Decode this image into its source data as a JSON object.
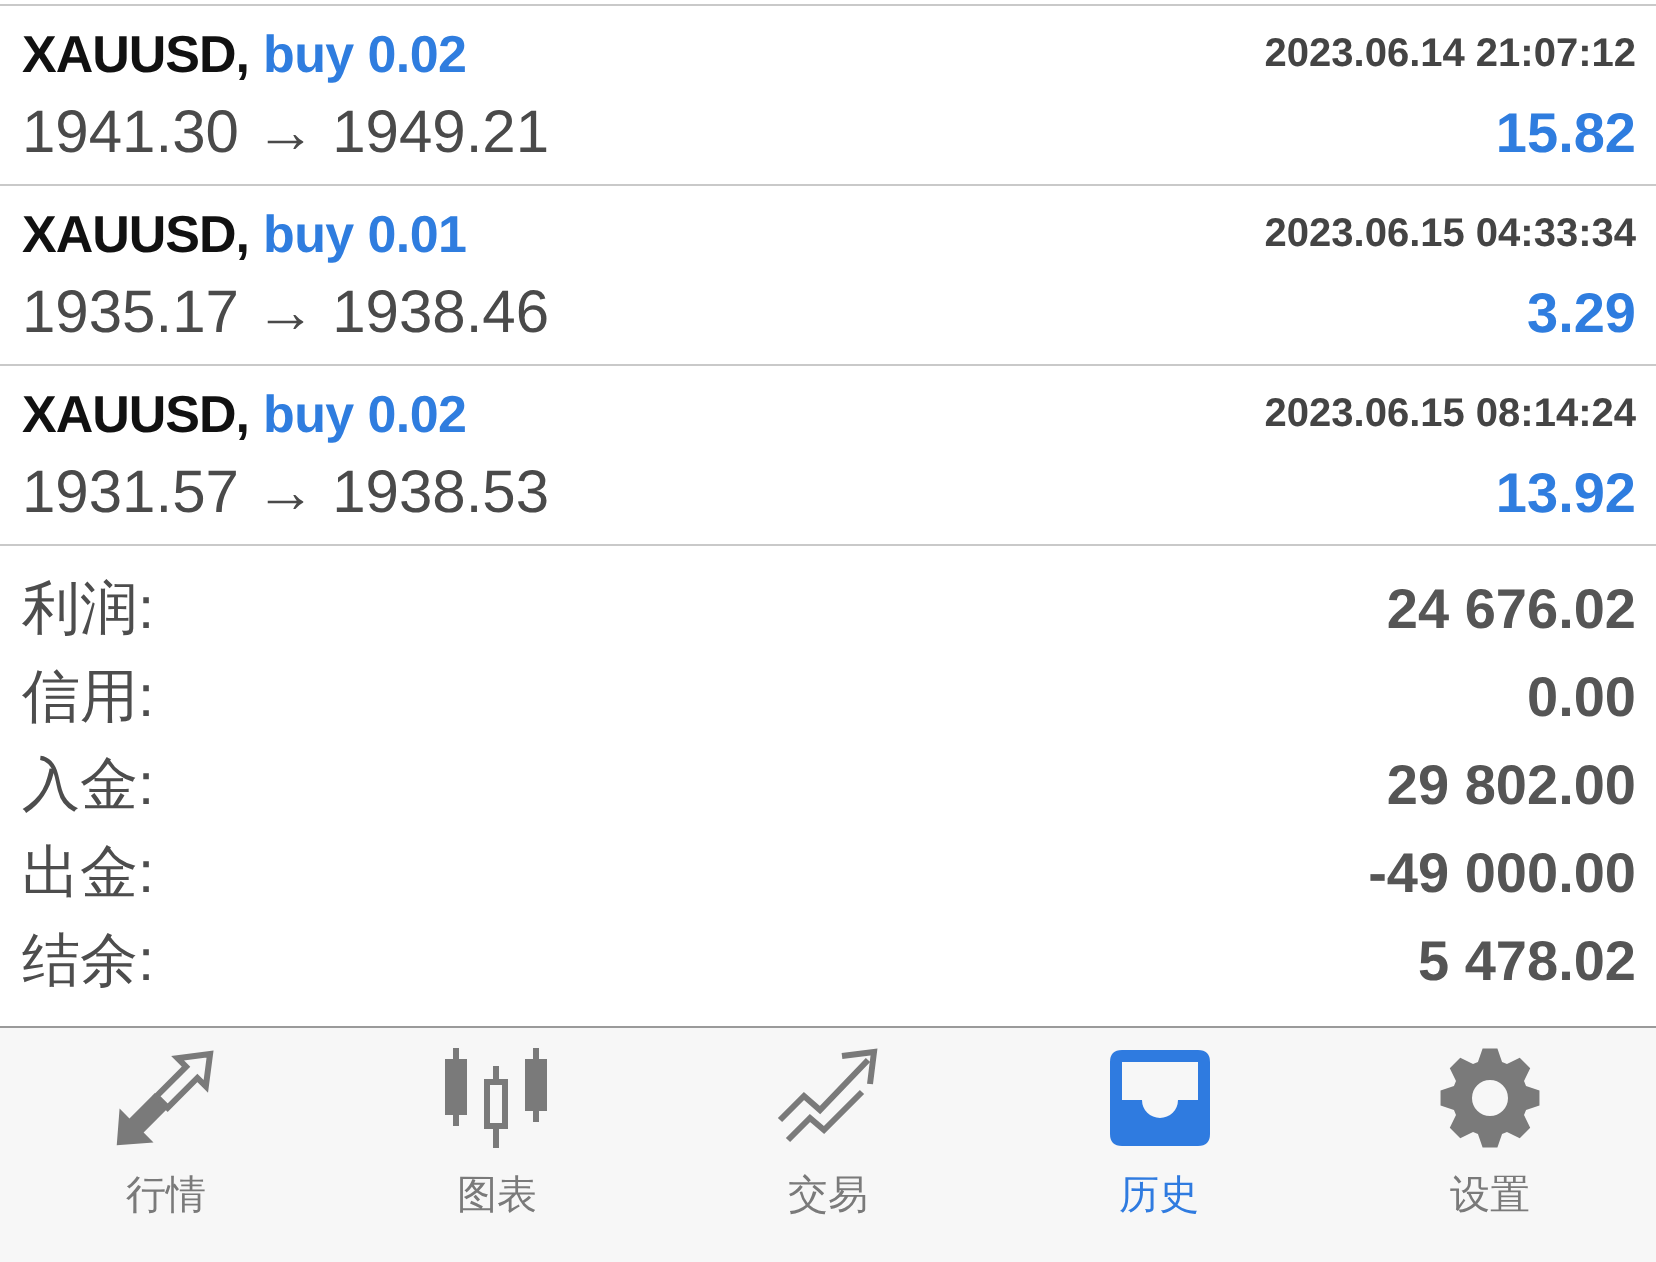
{
  "trades": [
    {
      "symbol": "XAUUSD,",
      "order": "buy 0.02",
      "time": "2023.06.14 21:07:12",
      "prices": "1941.30 → 1949.21",
      "profit": "15.82"
    },
    {
      "symbol": "XAUUSD,",
      "order": "buy 0.01",
      "time": "2023.06.15 04:33:34",
      "prices": "1935.17 → 1938.46",
      "profit": "3.29"
    },
    {
      "symbol": "XAUUSD,",
      "order": "buy 0.02",
      "time": "2023.06.15 08:14:24",
      "prices": "1931.57 → 1938.53",
      "profit": "13.92"
    }
  ],
  "summary": [
    {
      "label": "利润:",
      "value": "24 676.02"
    },
    {
      "label": "信用:",
      "value": "0.00"
    },
    {
      "label": "入金:",
      "value": "29 802.00"
    },
    {
      "label": "出金:",
      "value": "-49 000.00"
    },
    {
      "label": "结余:",
      "value": "5 478.02"
    }
  ],
  "tab_bar": {
    "tabs": [
      {
        "kind": "quotes",
        "label": "行情",
        "selected": false
      },
      {
        "kind": "chart",
        "label": "图表",
        "selected": false
      },
      {
        "kind": "trade",
        "label": "交易",
        "selected": false
      },
      {
        "kind": "history",
        "label": "历史",
        "selected": true
      },
      {
        "kind": "settings",
        "label": "设置",
        "selected": false
      }
    ]
  }
}
